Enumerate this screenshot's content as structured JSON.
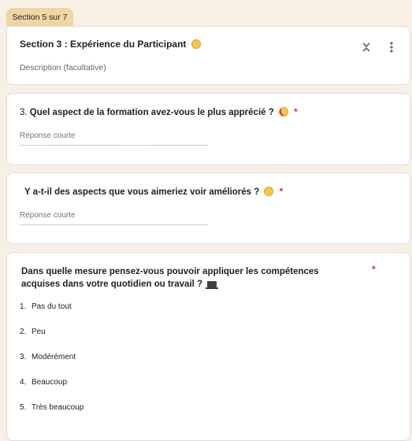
{
  "section_tab": "Section 5 sur 7",
  "section": {
    "title": "Section 3 : Expérience du Participant",
    "description_placeholder": "Description (facultative)"
  },
  "questions": [
    {
      "number": "3.",
      "title": "Quel aspect de la formation avez-vous le plus apprécié ?",
      "emoji": "heart-eyes-emoji",
      "required_mark": "*",
      "answer_placeholder": "Réponse courte"
    },
    {
      "number": "",
      "title": "Y a-t-il des aspects que vous aimeriez voir améliorés ?",
      "emoji": "thinking-emoji",
      "required_mark": "*",
      "answer_placeholder": "Réponse courte"
    },
    {
      "title": "Dans quelle mesure pensez-vous pouvoir appliquer les compétences acquises dans votre quotidien ou travail ?",
      "emoji": "laptop-emoji",
      "required_mark": "*",
      "options": [
        {
          "n": "1.",
          "label": "Pas du tout"
        },
        {
          "n": "2.",
          "label": "Peu"
        },
        {
          "n": "3.",
          "label": "Modérément"
        },
        {
          "n": "4.",
          "label": "Beaucoup"
        },
        {
          "n": "5.",
          "label": "Très beaucoup"
        }
      ]
    }
  ],
  "colors": {
    "background": "#f8f0e5",
    "tab": "#f0d6a4",
    "required": "#d93025"
  }
}
